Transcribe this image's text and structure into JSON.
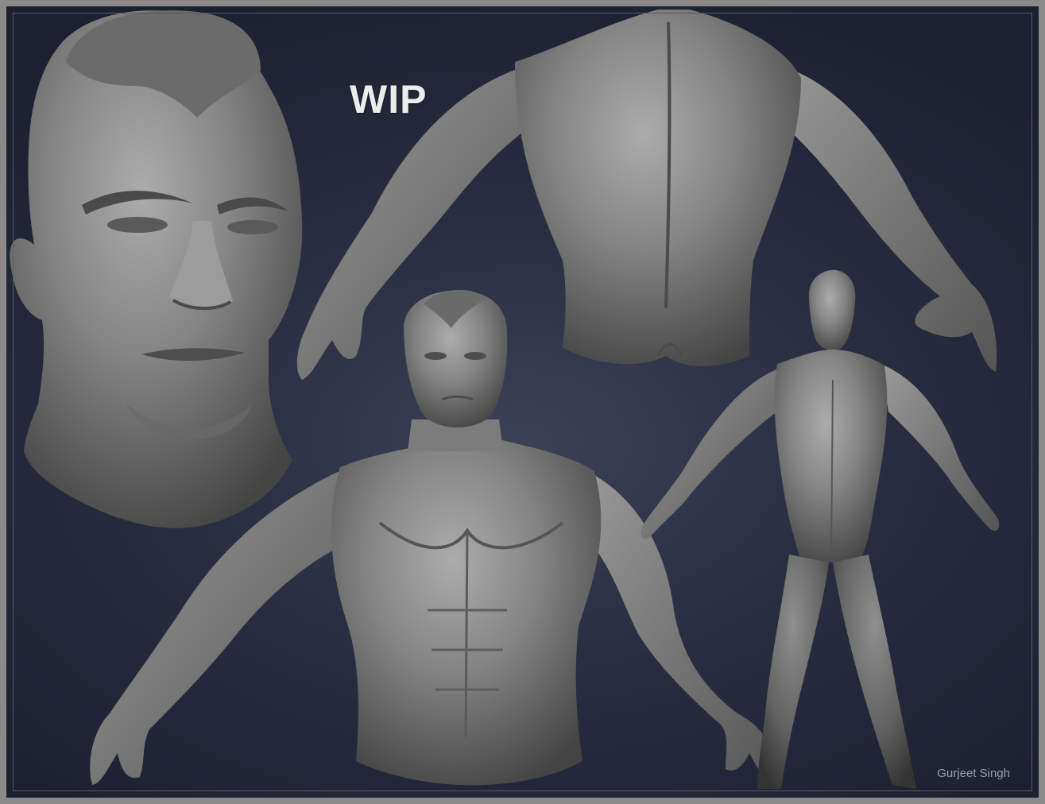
{
  "title": "WIP",
  "signature": "Gurjeet Singh",
  "figures": [
    {
      "name": "head-closeup"
    },
    {
      "name": "back-torso"
    },
    {
      "name": "front-torso"
    },
    {
      "name": "full-body"
    }
  ],
  "colors": {
    "background_center": "#3c4156",
    "background_edge": "#1d2031",
    "frame": "#8a8a8a",
    "sculpt_light": "#a9a9a9",
    "sculpt_mid": "#777777",
    "sculpt_dark": "#3e3e3e"
  }
}
